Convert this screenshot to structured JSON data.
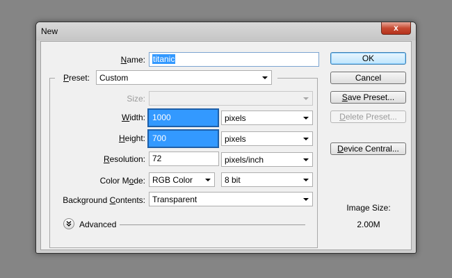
{
  "window": {
    "title": "New",
    "close_glyph": "x"
  },
  "name": {
    "label_u": "N",
    "label_rest": "ame:",
    "value": "titanic"
  },
  "preset": {
    "label_u": "P",
    "label_rest": "reset:",
    "value": "Custom"
  },
  "size": {
    "label": "Size:",
    "value": ""
  },
  "width": {
    "label_u": "W",
    "label_rest": "idth:",
    "value": "1000",
    "unit": "pixels"
  },
  "height": {
    "label_u": "H",
    "label_rest": "eight:",
    "value": "700",
    "unit": "pixels"
  },
  "resolution": {
    "label_u": "R",
    "label_rest": "esolution:",
    "value": "72",
    "unit": "pixels/inch"
  },
  "color_mode": {
    "label_a": "Color M",
    "label_u": "o",
    "label_b": "de:",
    "value": "RGB Color",
    "depth": "8 bit"
  },
  "background": {
    "label_a": "Background ",
    "label_u": "C",
    "label_b": "ontents:",
    "value": "Transparent"
  },
  "advanced": {
    "label": "Advanced"
  },
  "buttons": {
    "ok": "OK",
    "cancel": "Cancel",
    "save_u": "S",
    "save_rest": "ave Preset...",
    "delete_u": "D",
    "delete_rest": "elete Preset...",
    "device_u": "D",
    "device_rest": "evice Central..."
  },
  "image_size": {
    "label": "Image Size:",
    "value": "2.00M"
  }
}
